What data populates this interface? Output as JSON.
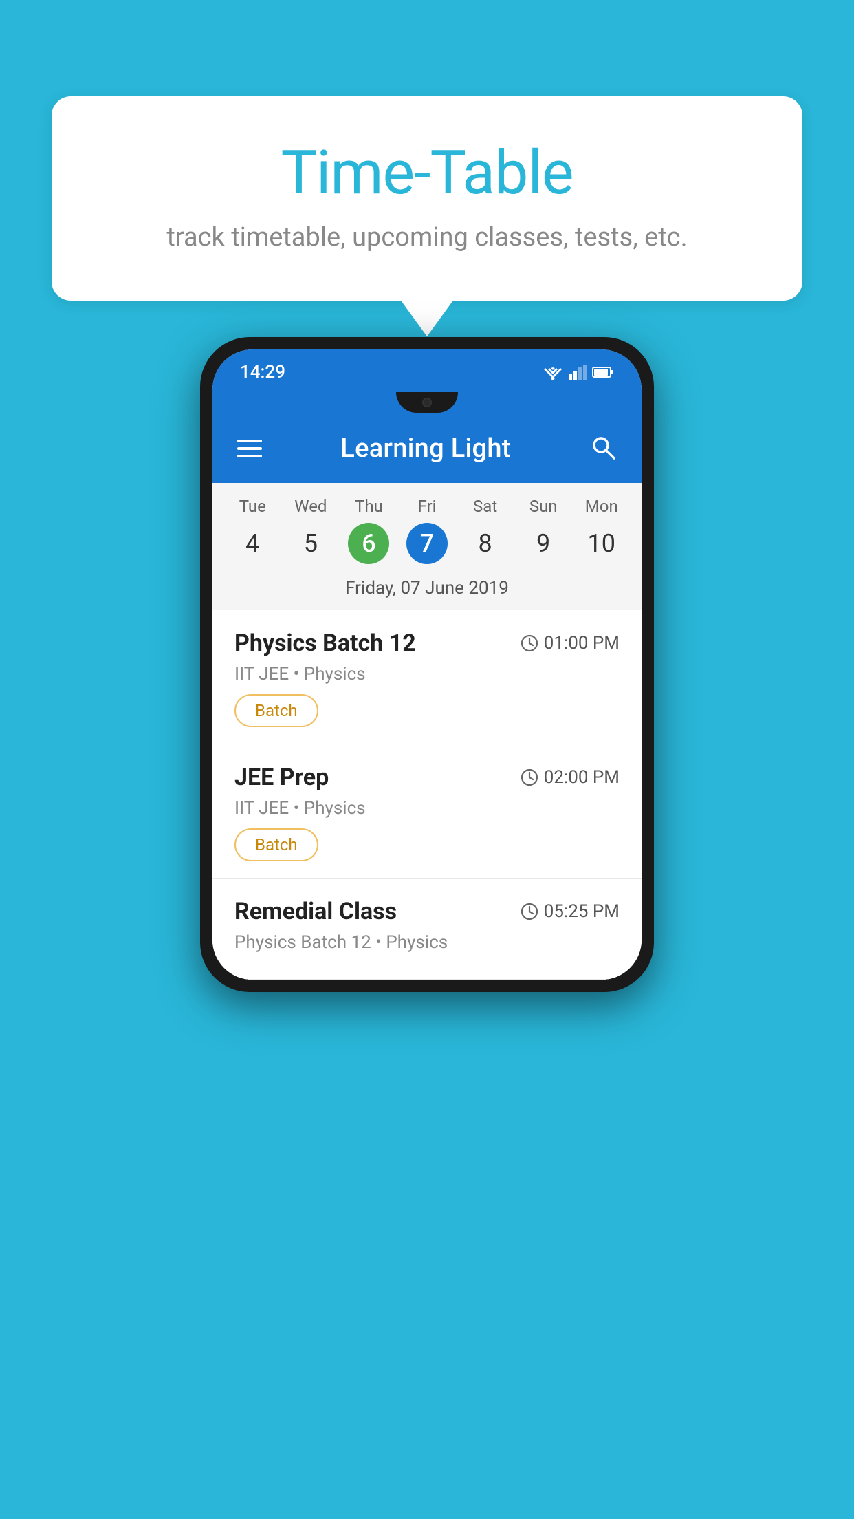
{
  "page": {
    "background_color": "#29b6d8"
  },
  "speech_bubble": {
    "title": "Time-Table",
    "subtitle": "track timetable, upcoming classes, tests, etc."
  },
  "phone": {
    "status_bar": {
      "time": "14:29"
    },
    "app_bar": {
      "title": "Learning Light"
    },
    "calendar": {
      "days": [
        {
          "name": "Tue",
          "num": "4",
          "state": "normal"
        },
        {
          "name": "Wed",
          "num": "5",
          "state": "normal"
        },
        {
          "name": "Thu",
          "num": "6",
          "state": "today"
        },
        {
          "name": "Fri",
          "num": "7",
          "state": "selected"
        },
        {
          "name": "Sat",
          "num": "8",
          "state": "normal"
        },
        {
          "name": "Sun",
          "num": "9",
          "state": "normal"
        },
        {
          "name": "Mon",
          "num": "10",
          "state": "normal"
        }
      ],
      "selected_date_label": "Friday, 07 June 2019"
    },
    "schedule": [
      {
        "title": "Physics Batch 12",
        "time": "01:00 PM",
        "subtitle": "IIT JEE • Physics",
        "tag": "Batch"
      },
      {
        "title": "JEE Prep",
        "time": "02:00 PM",
        "subtitle": "IIT JEE • Physics",
        "tag": "Batch"
      },
      {
        "title": "Remedial Class",
        "time": "05:25 PM",
        "subtitle": "Physics Batch 12 • Physics",
        "tag": null
      }
    ]
  }
}
